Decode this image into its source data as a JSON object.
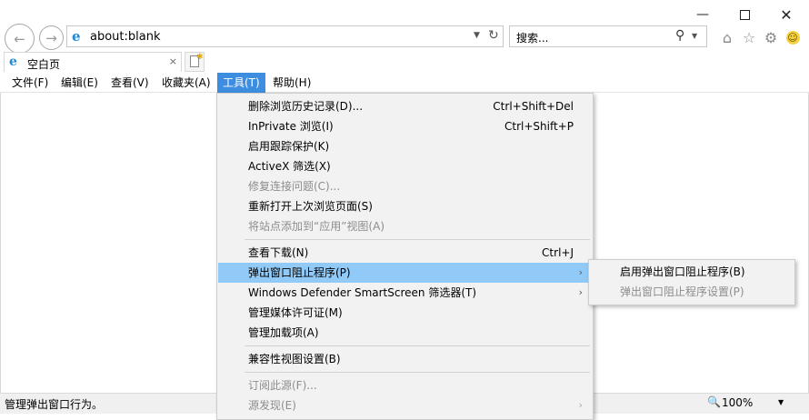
{
  "window": {
    "minimize_icon": "minimize-icon",
    "maximize_icon": "maximize-icon",
    "close_icon": "close-icon"
  },
  "nav": {
    "address": "about:blank",
    "search_placeholder": "搜索...",
    "icons": [
      "back-icon",
      "forward-icon",
      "ie-logo-icon",
      "dropdown-arrow-icon",
      "refresh-icon",
      "search-icon",
      "home-icon",
      "favorites-star-icon",
      "settings-gear-icon",
      "smiley-feedback-icon"
    ]
  },
  "tab": {
    "title": "空白页",
    "close": "×"
  },
  "menubar": {
    "items": [
      "文件(F)",
      "编辑(E)",
      "查看(V)",
      "收藏夹(A)",
      "工具(T)",
      "帮助(H)"
    ],
    "active": "工具(T)"
  },
  "tools_menu": {
    "items": [
      {
        "label": "删除浏览历史记录(D)...",
        "shortcut": "Ctrl+Shift+Del"
      },
      {
        "label": "InPrivate 浏览(I)",
        "shortcut": "Ctrl+Shift+P"
      },
      {
        "label": "启用跟踪保护(K)"
      },
      {
        "label": "ActiveX 筛选(X)"
      },
      {
        "label": "修复连接问题(C)...",
        "disabled": true
      },
      {
        "label": "重新打开上次浏览页面(S)"
      },
      {
        "label": "将站点添加到“应用”视图(A)",
        "disabled": true
      },
      {
        "label": "查看下载(N)",
        "shortcut": "Ctrl+J"
      },
      {
        "label": "弹出窗口阻止程序(P)",
        "submenu": true,
        "highlighted": true
      },
      {
        "label": "Windows Defender SmartScreen 筛选器(T)",
        "submenu": true
      },
      {
        "label": "管理媒体许可证(M)"
      },
      {
        "label": "管理加载项(A)"
      },
      {
        "label": "兼容性视图设置(B)"
      },
      {
        "label": "订阅此源(F)...",
        "disabled": true
      },
      {
        "label": "源发现(E)",
        "disabled": true,
        "submenu": true
      }
    ]
  },
  "popup_submenu": {
    "items": [
      {
        "label": "启用弹出窗口阻止程序(B)"
      },
      {
        "label": "弹出窗口阻止程序设置(P)",
        "disabled": true
      }
    ]
  },
  "status": {
    "text": "管理弹出窗口行为。",
    "zoom": "100%"
  },
  "colors": {
    "menu_active": "#3d8ee0",
    "menu_highlight": "#91c9f7",
    "menu_bg": "#f2f2f2",
    "ie_blue": "#1e8ad6"
  }
}
